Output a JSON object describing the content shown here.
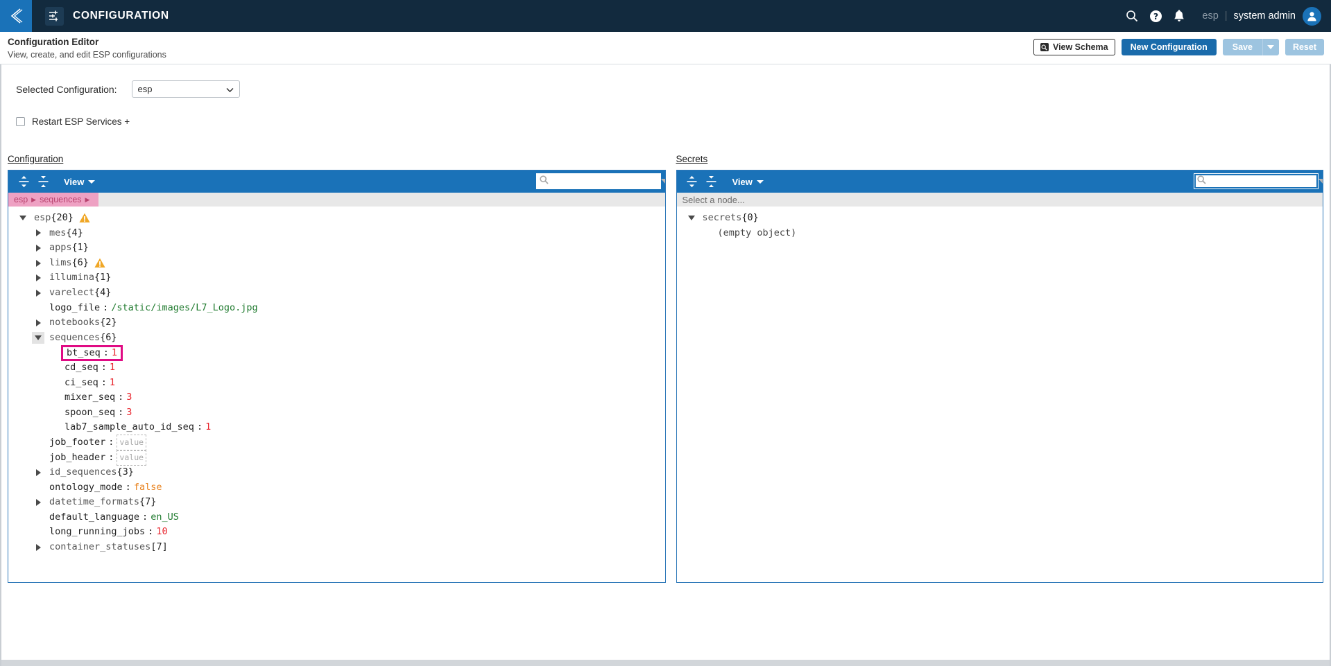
{
  "topbar": {
    "back_icon": "chevron-left-icon",
    "app_icon": "sliders-icon",
    "title": "CONFIGURATION",
    "search_icon": "search-icon",
    "help_icon": "help-circle-icon",
    "notifications_icon": "bell-icon",
    "tenant": "esp",
    "separator": "|",
    "user": "system admin",
    "avatar_icon": "user-avatar-icon",
    "bg_color": "#122a3e",
    "accent_color": "#1a72b8"
  },
  "subheader": {
    "title": "Configuration Editor",
    "subtitle": "View, create, and edit ESP configurations",
    "view_schema_label": "View Schema",
    "view_schema_icon": "schema-search-icon",
    "new_configuration_label": "New Configuration",
    "save_label": "Save",
    "save_caret_icon": "chevron-down-icon",
    "reset_label": "Reset",
    "primary_color": "#1a6bab",
    "disabled_color": "#9dc4e0"
  },
  "controls": {
    "selected_configuration_label": "Selected Configuration:",
    "selected_configuration_value": "esp",
    "restart_label": "Restart ESP Services +",
    "restart_checked": false
  },
  "panels": {
    "configuration": {
      "heading": "Configuration",
      "toolbar": {
        "expand_all_icon": "expand-all-icon",
        "collapse_all_icon": "collapse-all-icon",
        "view_label": "View",
        "view_caret_icon": "chevron-down-icon"
      },
      "search": {
        "icon": "search-icon",
        "value": "",
        "placeholder": "",
        "prev_icon": "triangle-up-icon",
        "next_icon": "triangle-down-icon",
        "focused": false
      },
      "breadcrumb": {
        "items": [
          "esp",
          "sequences"
        ],
        "separator": "▶"
      },
      "tree": [
        {
          "indent": 0,
          "toggle": "down",
          "key": "esp",
          "count": "{20}",
          "warning": true
        },
        {
          "indent": 1,
          "toggle": "right",
          "key": "mes",
          "count": "{4}"
        },
        {
          "indent": 1,
          "toggle": "right",
          "key": "apps",
          "count": "{1}"
        },
        {
          "indent": 1,
          "toggle": "right",
          "key": "lims",
          "count": "{6}",
          "warning": true
        },
        {
          "indent": 1,
          "toggle": "right",
          "key": "illumina",
          "count": "{1}"
        },
        {
          "indent": 1,
          "toggle": "right",
          "key": "varelect",
          "count": "{4}"
        },
        {
          "indent": 1,
          "toggle": "none",
          "key": "logo_file",
          "value": "/static/images/L7_Logo.jpg",
          "valtype": "string"
        },
        {
          "indent": 1,
          "toggle": "right",
          "key": "notebooks",
          "count": "{2}"
        },
        {
          "indent": 1,
          "toggle": "down",
          "key": "sequences",
          "count": "{6}",
          "toggle_boxed": true
        },
        {
          "indent": 2,
          "toggle": "none",
          "key": "bt_seq",
          "value": "1",
          "valtype": "number",
          "highlighted": true
        },
        {
          "indent": 2,
          "toggle": "none",
          "key": "cd_seq",
          "value": "1",
          "valtype": "number"
        },
        {
          "indent": 2,
          "toggle": "none",
          "key": "ci_seq",
          "value": "1",
          "valtype": "number"
        },
        {
          "indent": 2,
          "toggle": "none",
          "key": "mixer_seq",
          "value": "3",
          "valtype": "number"
        },
        {
          "indent": 2,
          "toggle": "none",
          "key": "spoon_seq",
          "value": "3",
          "valtype": "number"
        },
        {
          "indent": 2,
          "toggle": "none",
          "key": "lab7_sample_auto_id_seq",
          "value": "1",
          "valtype": "number"
        },
        {
          "indent": 1,
          "toggle": "none",
          "key": "job_footer",
          "value": "value",
          "valtype": "placeholder"
        },
        {
          "indent": 1,
          "toggle": "none",
          "key": "job_header",
          "value": "value",
          "valtype": "placeholder"
        },
        {
          "indent": 1,
          "toggle": "right",
          "key": "id_sequences",
          "count": "{3}"
        },
        {
          "indent": 1,
          "toggle": "none",
          "key": "ontology_mode",
          "value": "false",
          "valtype": "bool"
        },
        {
          "indent": 1,
          "toggle": "right",
          "key": "datetime_formats",
          "count": "{7}"
        },
        {
          "indent": 1,
          "toggle": "none",
          "key": "default_language",
          "value": "en_US",
          "valtype": "string"
        },
        {
          "indent": 1,
          "toggle": "none",
          "key": "long_running_jobs",
          "value": "10",
          "valtype": "number"
        },
        {
          "indent": 1,
          "toggle": "right",
          "key": "container_statuses",
          "count": "[7]"
        }
      ]
    },
    "secrets": {
      "heading": "Secrets",
      "toolbar": {
        "expand_all_icon": "expand-all-icon",
        "collapse_all_icon": "collapse-all-icon",
        "view_label": "View",
        "view_caret_icon": "chevron-down-icon"
      },
      "search": {
        "icon": "search-icon",
        "value": "",
        "placeholder": "",
        "prev_icon": "triangle-up-icon",
        "next_icon": "triangle-down-icon",
        "focused": true
      },
      "breadcrumb_placeholder": "Select a node...",
      "tree": [
        {
          "indent": 0,
          "toggle": "down",
          "key": "secrets",
          "count": "{0}"
        },
        {
          "indent": 1,
          "toggle": "none",
          "note": "(empty object)"
        }
      ]
    }
  },
  "colors": {
    "highlight_box": "#e00b84",
    "breadcrumb_active_bg": "#eea1c3",
    "breadcrumb_active_fg": "#b9436f",
    "panel_border": "#2f79b9",
    "toolbar_blue": "#1a72b8",
    "warning": "#f0a726",
    "number": "#e8262e",
    "string": "#1f7a2e",
    "bool": "#e8821e"
  }
}
